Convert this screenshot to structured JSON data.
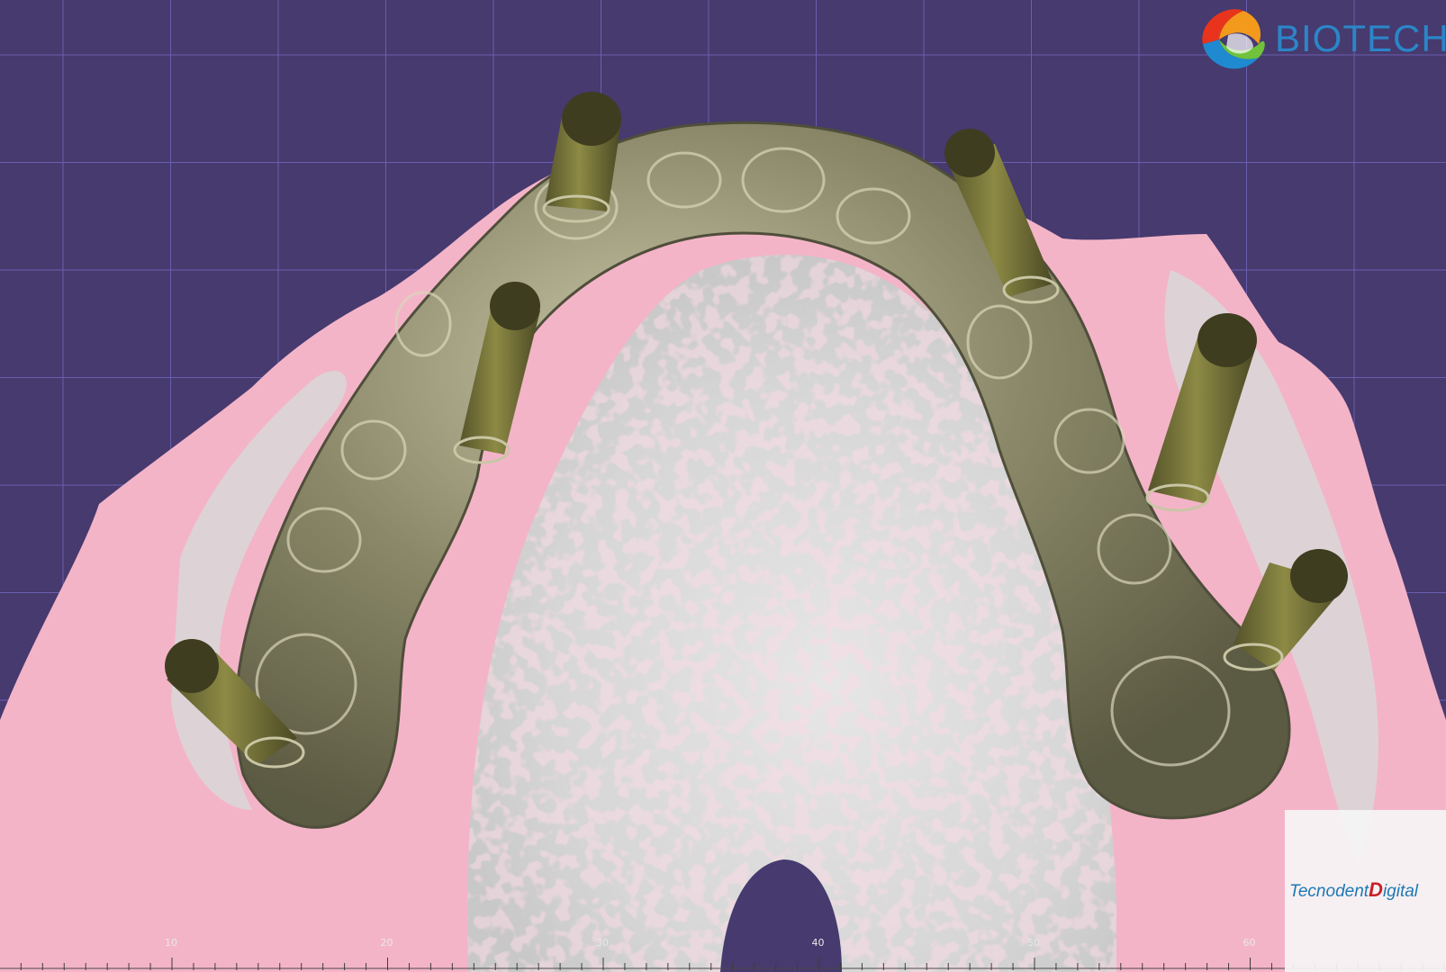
{
  "viewer": {
    "background": "#463a6e",
    "grid_color": "#6a5fb0",
    "ruler": {
      "tick_labels": [
        "10",
        "20",
        "30",
        "40",
        "50",
        "60"
      ]
    }
  },
  "model": {
    "gingiva_color": "#f4b4c8",
    "cast_color": "#dcdcdc",
    "framework_color": "#7d7b5e",
    "implant_color": "#6f6b34"
  },
  "branding": {
    "top_logo": {
      "text": "BIOTECH",
      "color": "#2b86c9"
    },
    "corner_logo": {
      "part1": "Tecnodent",
      "part2": "D",
      "part3": "igital"
    }
  }
}
